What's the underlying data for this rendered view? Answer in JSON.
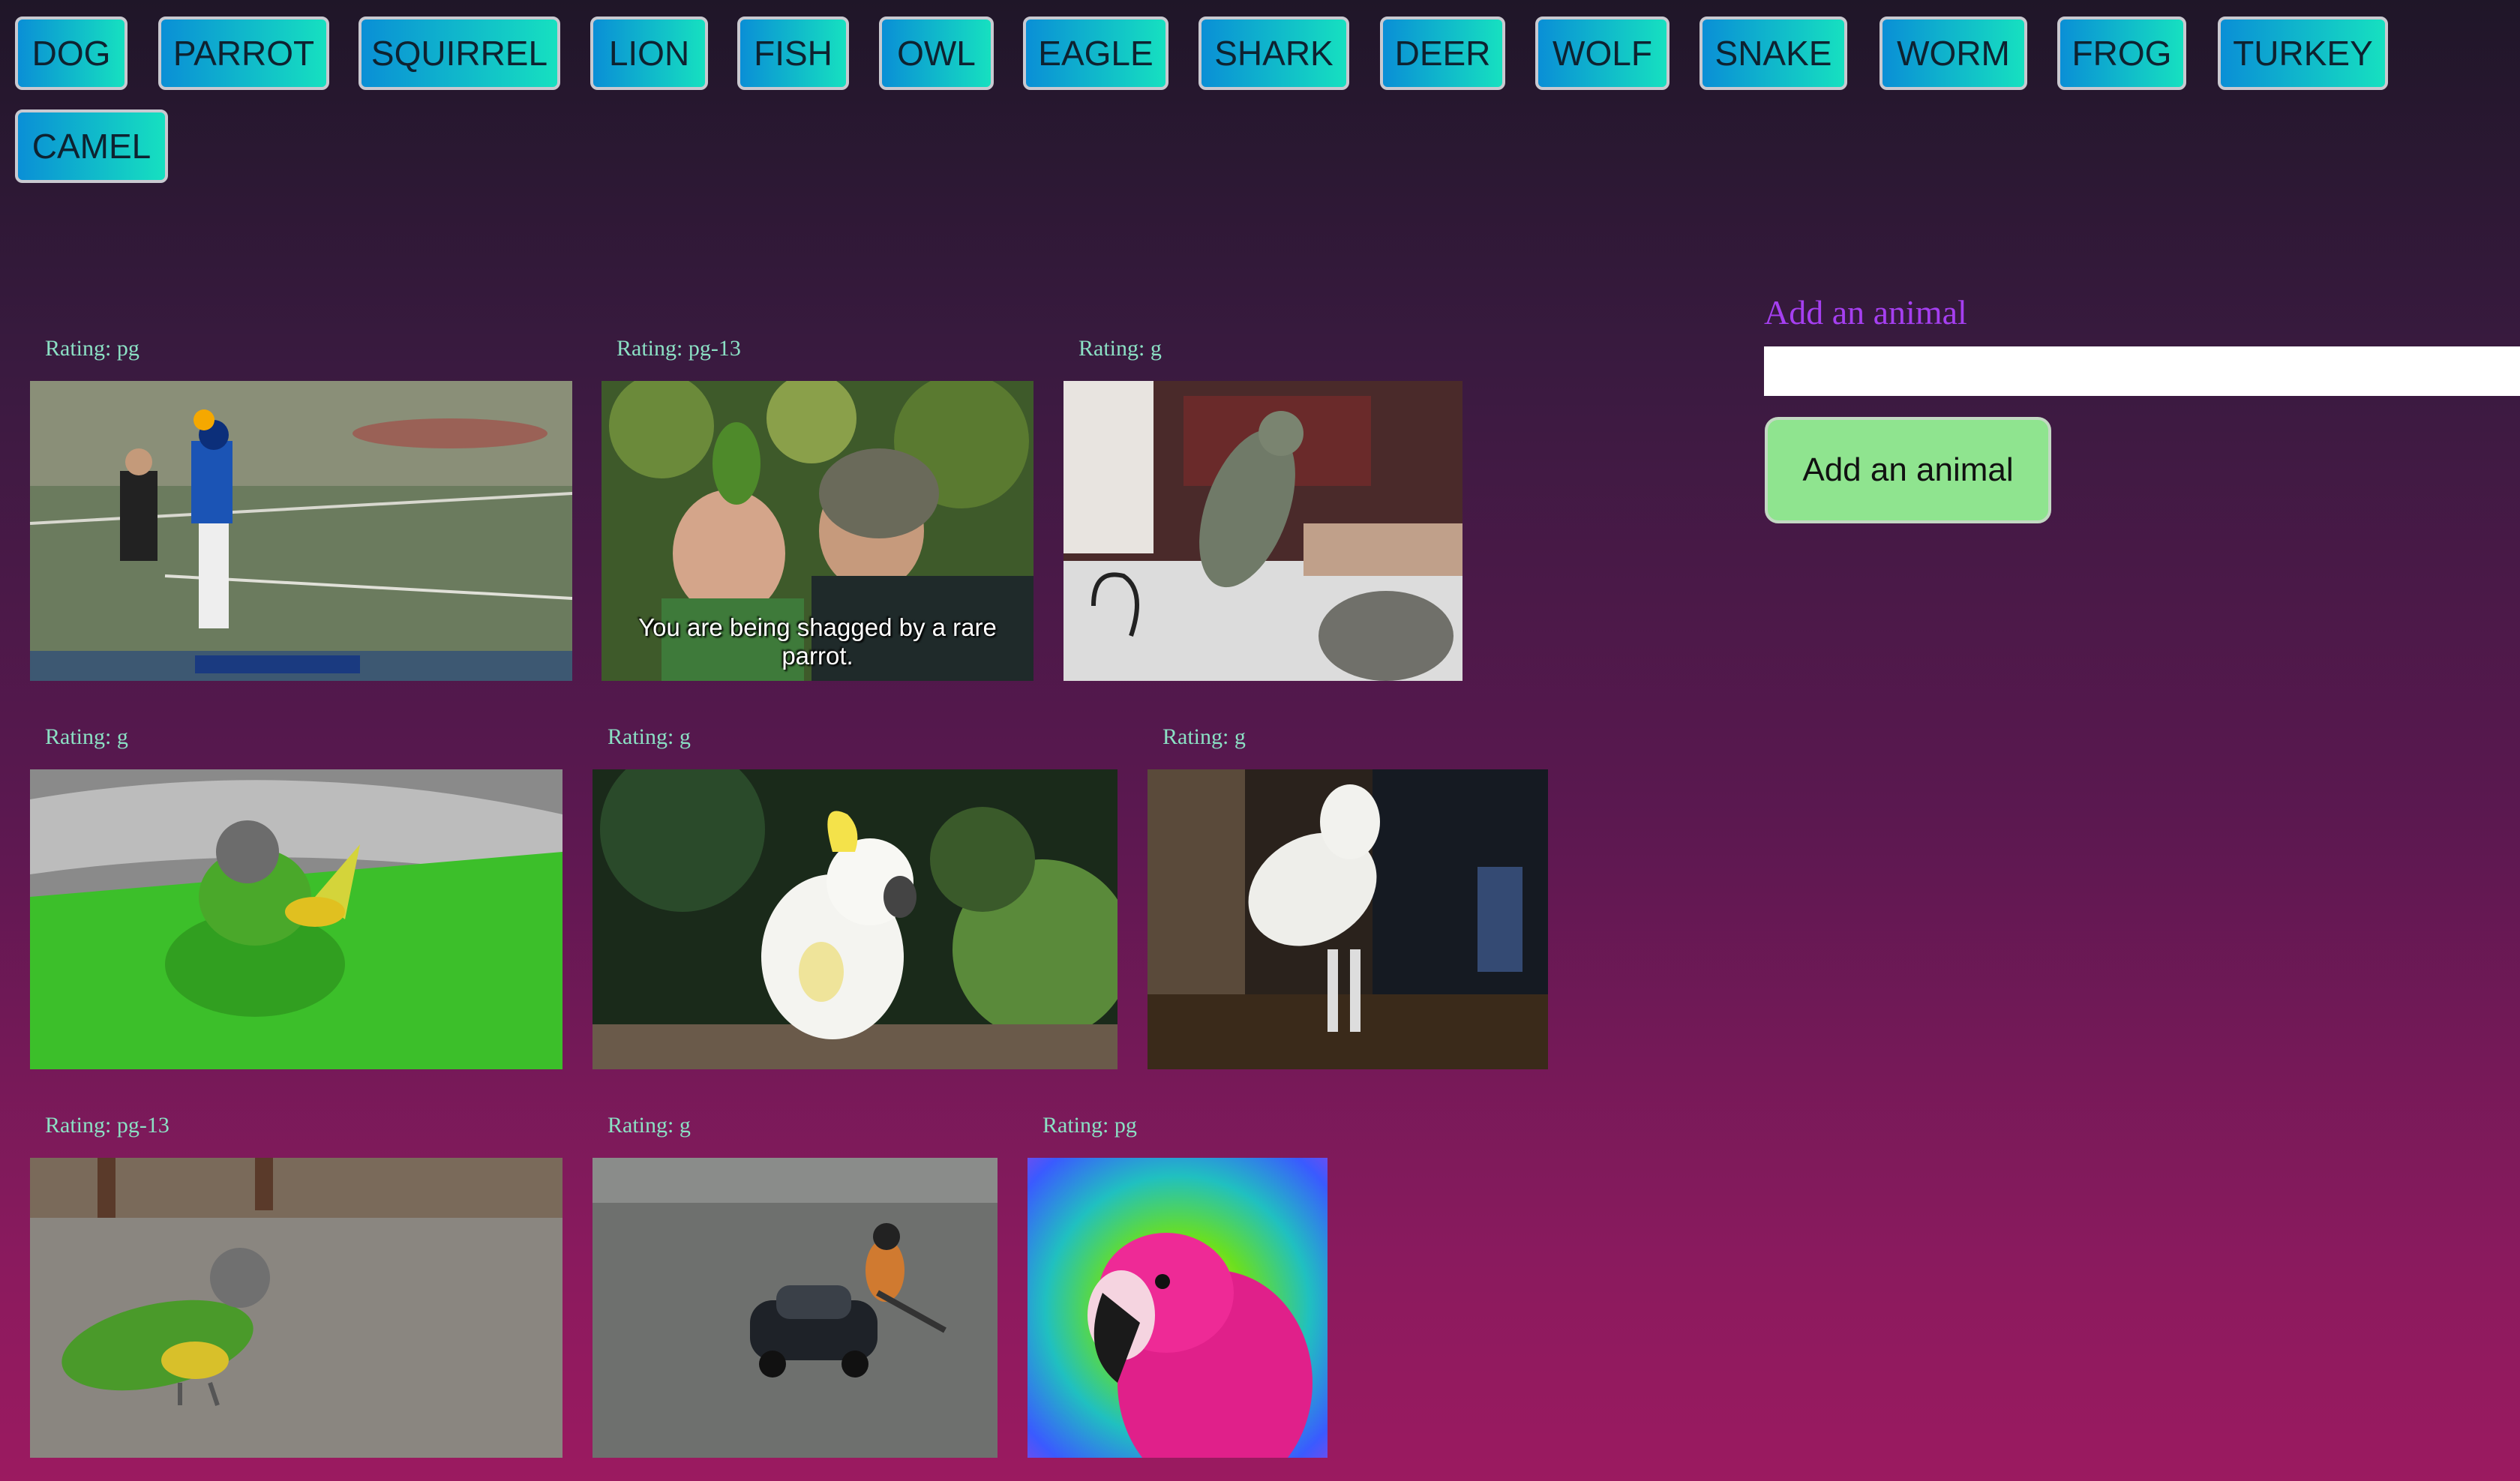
{
  "topics": [
    "DOG",
    "PARROT",
    "SQUIRREL",
    "LION",
    "FISH",
    "OWL",
    "EAGLE",
    "SHARK",
    "DEER",
    "WOLF",
    "SNAKE",
    "WORM",
    "FROG",
    "TURKEY",
    "CAMEL"
  ],
  "gifs": [
    {
      "rating": "Rating: pg",
      "caption": "",
      "icon": "baseball-parrot-gif"
    },
    {
      "rating": "Rating: pg-13",
      "caption": "You are being shagged by a rare parrot.",
      "icon": "parrot-on-man-gif"
    },
    {
      "rating": "Rating: g",
      "caption": "",
      "icon": "gray-parrot-walking-gif"
    },
    {
      "rating": "Rating: g",
      "caption": "",
      "icon": "parrot-on-green-table-gif"
    },
    {
      "rating": "Rating: g",
      "caption": "",
      "icon": "cockatoo-gif"
    },
    {
      "rating": "Rating: g",
      "caption": "",
      "icon": "cockatoo-dancing-gif"
    },
    {
      "rating": "Rating: pg-13",
      "caption": "",
      "icon": "green-parrot-walking-gif"
    },
    {
      "rating": "Rating: g",
      "caption": "",
      "icon": "bird-on-toy-car-gif"
    },
    {
      "rating": "Rating: pg",
      "caption": "",
      "icon": "pink-parrot-rainbow-gif"
    }
  ],
  "form": {
    "title": "Add an animal",
    "input_value": "",
    "submit_label": "Add an animal"
  }
}
